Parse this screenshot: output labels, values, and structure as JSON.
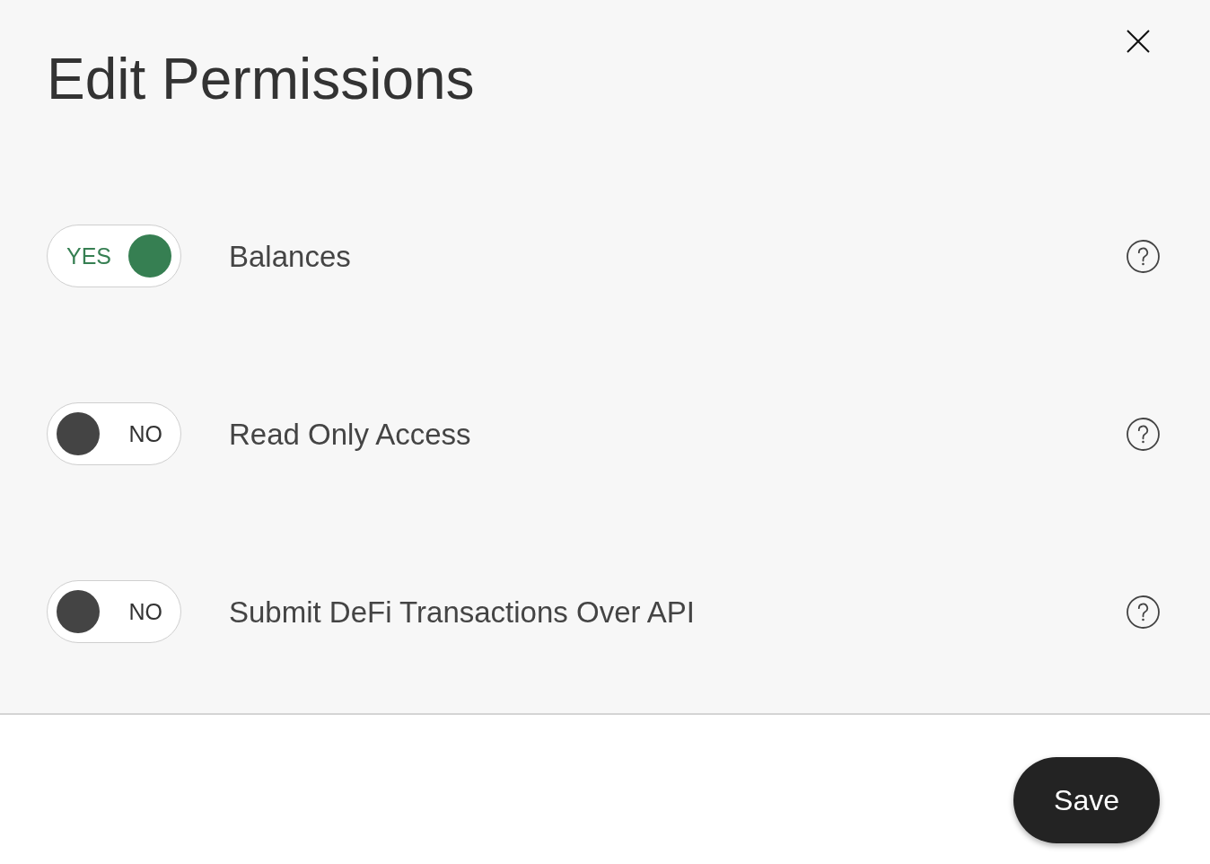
{
  "dialog": {
    "title": "Edit Permissions"
  },
  "permissions": [
    {
      "label": "Balances",
      "on": true,
      "state_text": "YES"
    },
    {
      "label": "Read Only Access",
      "on": false,
      "state_text": "NO"
    },
    {
      "label": "Submit DeFi Transactions Over API",
      "on": false,
      "state_text": "NO"
    }
  ],
  "footer": {
    "save_button": "Save"
  }
}
